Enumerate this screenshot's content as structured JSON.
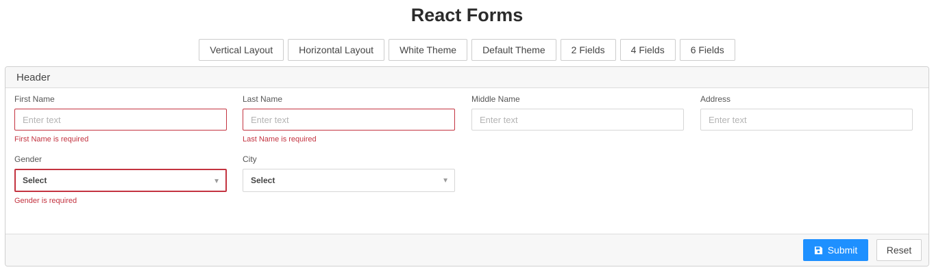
{
  "page": {
    "title": "React Forms"
  },
  "toolbar": {
    "buttons": [
      {
        "label": "Vertical Layout"
      },
      {
        "label": "Horizontal Layout"
      },
      {
        "label": "White Theme"
      },
      {
        "label": "Default Theme"
      },
      {
        "label": "2 Fields"
      },
      {
        "label": "4 Fields"
      },
      {
        "label": "6 Fields"
      }
    ]
  },
  "panel": {
    "header": "Header",
    "fields": {
      "first_name": {
        "label": "First Name",
        "placeholder": "Enter text",
        "value": "",
        "error": "First Name is required"
      },
      "last_name": {
        "label": "Last Name",
        "placeholder": "Enter text",
        "value": "",
        "error": "Last Name is required"
      },
      "middle_name": {
        "label": "Middle Name",
        "placeholder": "Enter text",
        "value": ""
      },
      "address": {
        "label": "Address",
        "placeholder": "Enter text",
        "value": ""
      },
      "gender": {
        "label": "Gender",
        "selected": "Select",
        "error": "Gender is required"
      },
      "city": {
        "label": "City",
        "selected": "Select"
      }
    },
    "footer": {
      "submit_label": "Submit",
      "submit_icon": "save-icon",
      "reset_label": "Reset"
    }
  },
  "colors": {
    "primary": "#1e90ff",
    "error": "#c3323f",
    "border": "#d6d6d6"
  }
}
